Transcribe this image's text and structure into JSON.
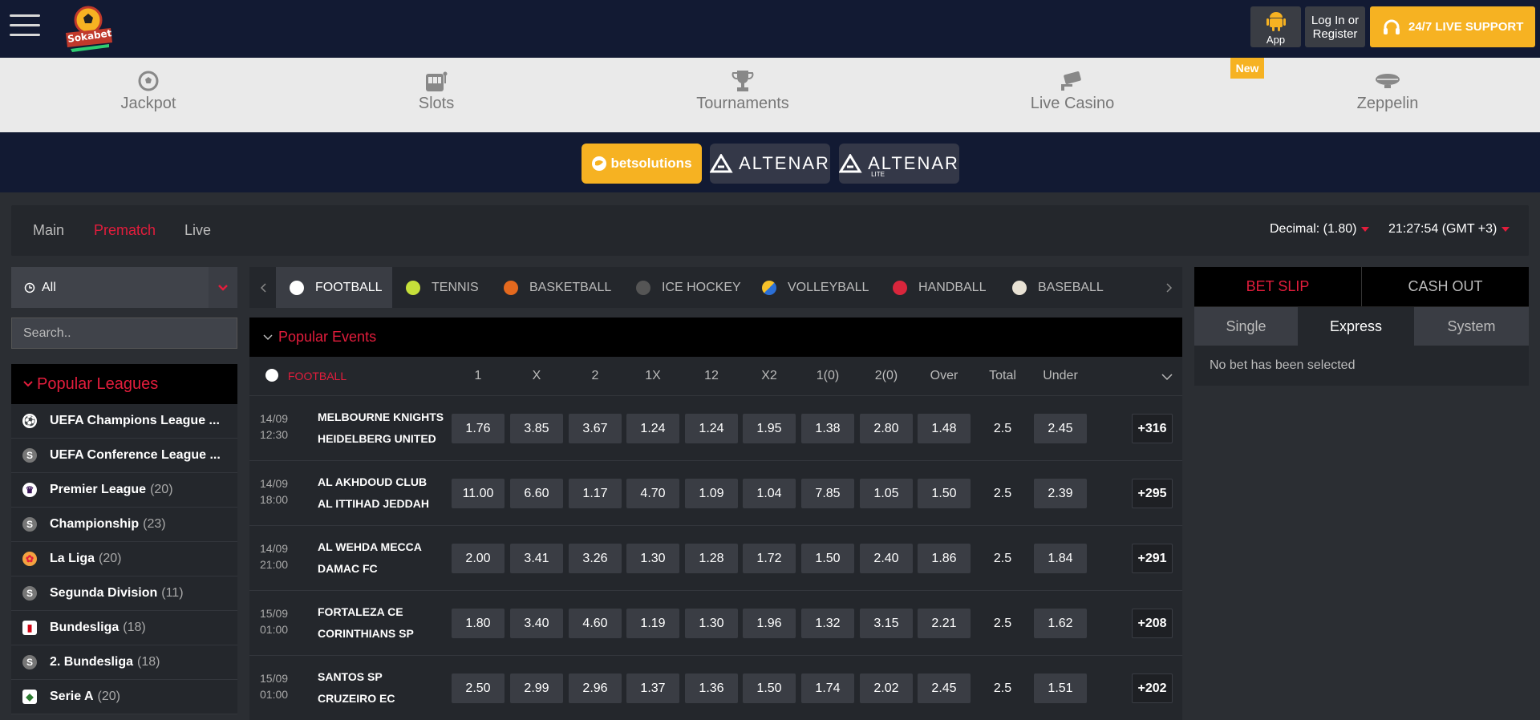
{
  "topbar": {
    "logo_text": "Sokabet",
    "app_label": "App",
    "login_line1": "Log In or",
    "login_line2": "Register",
    "support_label": "24/7 LIVE SUPPORT"
  },
  "categories": [
    {
      "label": "Jackpot",
      "icon": "soccer-ball-icon"
    },
    {
      "label": "Slots",
      "icon": "slot-machine-icon"
    },
    {
      "label": "Tournaments",
      "icon": "trophy-icon"
    },
    {
      "label": "Live Casino",
      "icon": "camera-icon"
    },
    {
      "label": "Zeppelin",
      "icon": "zeppelin-icon"
    }
  ],
  "new_badge": "New",
  "providers": [
    {
      "label": "betsolutions",
      "active": true
    },
    {
      "label": "ALTENAR",
      "active": false
    },
    {
      "label": "ALTENAR",
      "sub": "LITE",
      "active": false
    }
  ],
  "main_tabs": [
    {
      "label": "Main",
      "active": false
    },
    {
      "label": "Prematch",
      "active": true
    },
    {
      "label": "Live",
      "active": false
    }
  ],
  "odds_format": "Decimal: (1.80)",
  "clock": "21:27:54 (GMT +3)",
  "sport_select": {
    "value": "All"
  },
  "search": {
    "placeholder": "Search.."
  },
  "popular_leagues": {
    "title": "Popular Leagues",
    "items": [
      {
        "name": "UEFA Champions League ...",
        "count": ""
      },
      {
        "name": "UEFA Conference League ...",
        "count": ""
      },
      {
        "name": "Premier League",
        "count": "(20)"
      },
      {
        "name": "Championship",
        "count": "(23)"
      },
      {
        "name": "La Liga",
        "count": "(20)"
      },
      {
        "name": "Segunda Division",
        "count": "(11)"
      },
      {
        "name": "Bundesliga",
        "count": "(18)"
      },
      {
        "name": "2. Bundesliga",
        "count": "(18)"
      },
      {
        "name": "Serie A",
        "count": "(20)"
      }
    ]
  },
  "sports": [
    {
      "label": "FOOTBALL",
      "active": true
    },
    {
      "label": "TENNIS",
      "active": false
    },
    {
      "label": "BASKETBALL",
      "active": false
    },
    {
      "label": "ICE HOCKEY",
      "active": false
    },
    {
      "label": "VOLLEYBALL",
      "active": false
    },
    {
      "label": "HANDBALL",
      "active": false
    },
    {
      "label": "BASEBALL",
      "active": false
    }
  ],
  "popular_events": {
    "title": "Popular Events",
    "sport_label": "FOOTBALL",
    "columns": [
      "1",
      "X",
      "2",
      "1X",
      "12",
      "X2",
      "1(0)",
      "2(0)",
      "Over",
      "Total",
      "Under"
    ],
    "rows": [
      {
        "date": "14/09",
        "time": "12:30",
        "home": "MELBOURNE KNIGHTS",
        "away": "HEIDELBERG UNITED",
        "odds": [
          "1.76",
          "3.85",
          "3.67",
          "1.24",
          "1.24",
          "1.95",
          "1.38",
          "2.80",
          "1.48",
          "2.5",
          "2.45"
        ],
        "more": "+316"
      },
      {
        "date": "14/09",
        "time": "18:00",
        "home": "AL AKHDOUD CLUB",
        "away": "AL ITTIHAD JEDDAH",
        "odds": [
          "11.00",
          "6.60",
          "1.17",
          "4.70",
          "1.09",
          "1.04",
          "7.85",
          "1.05",
          "1.50",
          "2.5",
          "2.39"
        ],
        "more": "+295"
      },
      {
        "date": "14/09",
        "time": "21:00",
        "home": "AL WEHDA MECCA",
        "away": "DAMAC FC",
        "odds": [
          "2.00",
          "3.41",
          "3.26",
          "1.30",
          "1.28",
          "1.72",
          "1.50",
          "2.40",
          "1.86",
          "2.5",
          "1.84"
        ],
        "more": "+291"
      },
      {
        "date": "15/09",
        "time": "01:00",
        "home": "FORTALEZA CE",
        "away": "CORINTHIANS SP",
        "odds": [
          "1.80",
          "3.40",
          "4.60",
          "1.19",
          "1.30",
          "1.96",
          "1.32",
          "3.15",
          "2.21",
          "2.5",
          "1.62"
        ],
        "more": "+208"
      },
      {
        "date": "15/09",
        "time": "01:00",
        "home": "SANTOS SP",
        "away": "CRUZEIRO EC",
        "odds": [
          "2.50",
          "2.99",
          "2.96",
          "1.37",
          "1.36",
          "1.50",
          "1.74",
          "2.02",
          "2.45",
          "2.5",
          "1.51"
        ],
        "more": "+202"
      }
    ]
  },
  "betslip": {
    "tab_betslip": "BET SLIP",
    "tab_cashout": "CASH OUT",
    "sub_single": "Single",
    "sub_express": "Express",
    "sub_system": "System",
    "empty_text": "No bet has been selected"
  },
  "colors": {
    "accent": "#e31d3c",
    "yellow": "#f6b222",
    "navy": "#121a33"
  }
}
